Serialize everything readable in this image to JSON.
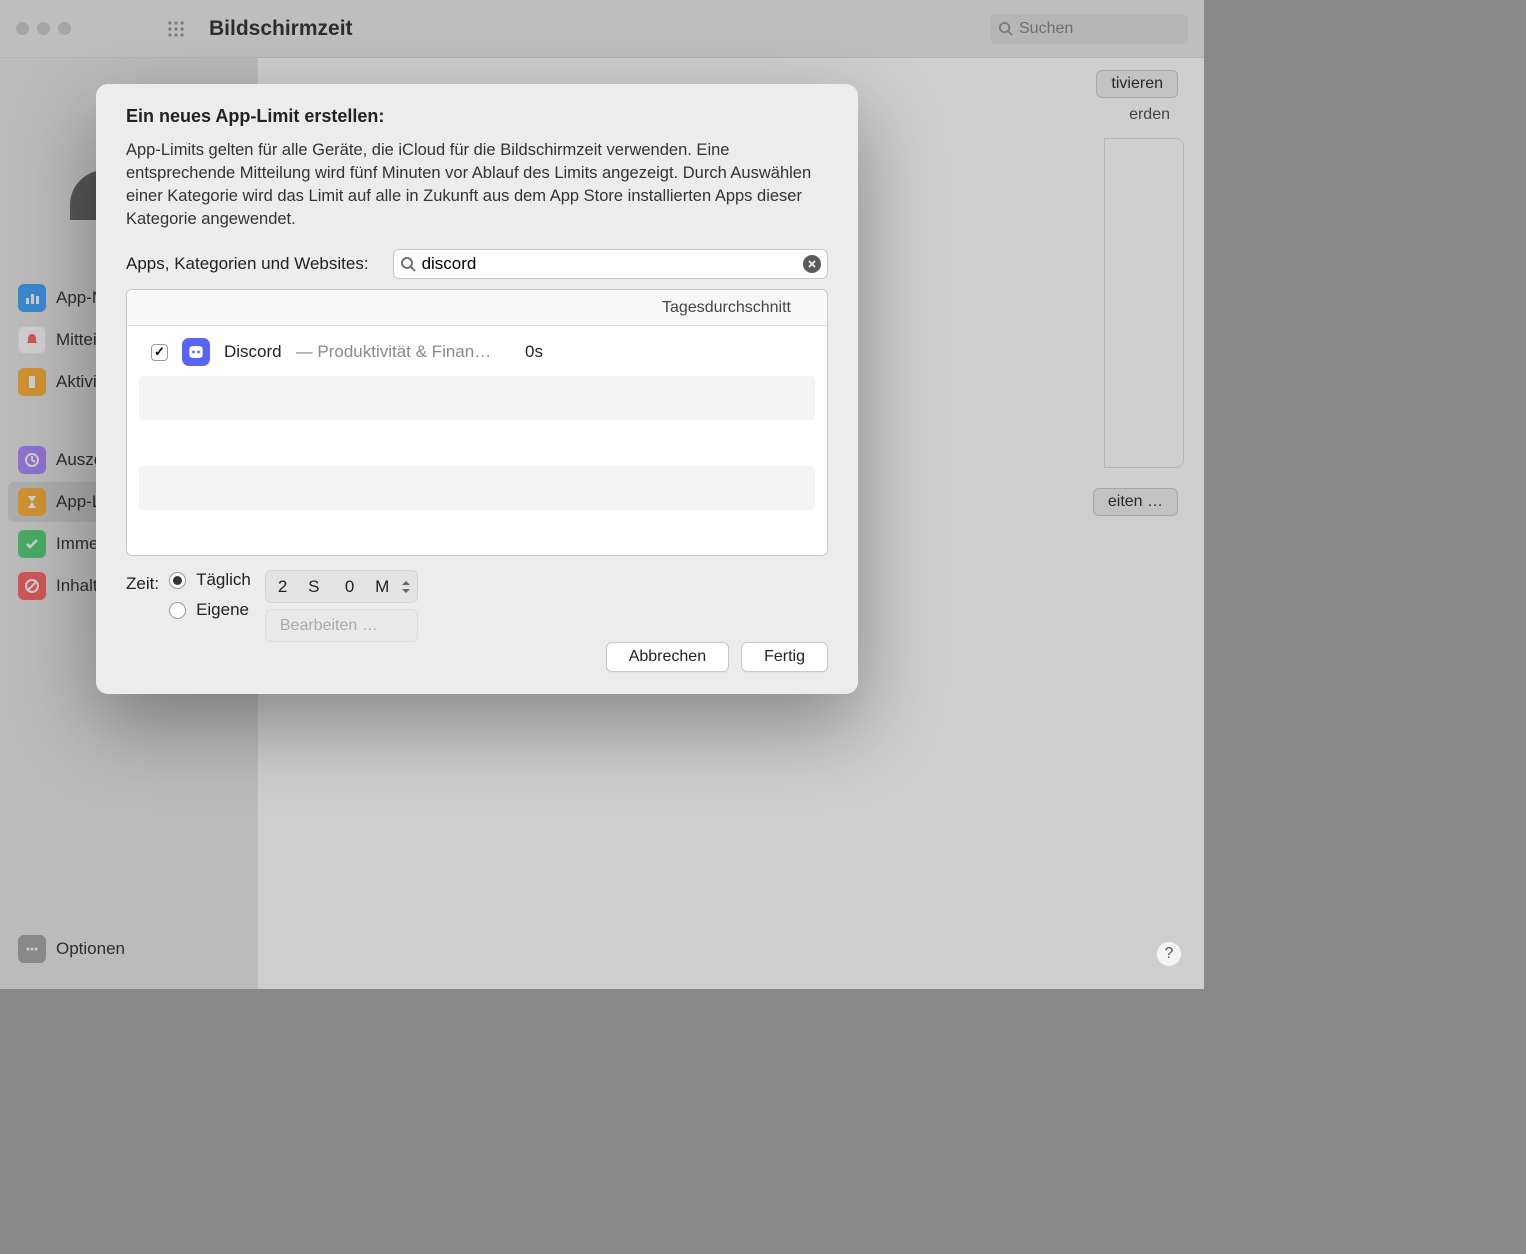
{
  "window": {
    "title": "Bildschirmzeit",
    "search_placeholder": "Suchen"
  },
  "sidebar": {
    "items": [
      {
        "label": "App-Nutzung"
      },
      {
        "label": "Mitteilungen"
      },
      {
        "label": "Aktivierungen"
      }
    ],
    "items2": [
      {
        "label": "Auszeit"
      },
      {
        "label": "App-Limits"
      },
      {
        "label": "Immer erlauben"
      },
      {
        "label": "Inhalt & Datenschutz"
      }
    ],
    "options_label": "Optionen"
  },
  "background": {
    "button_partial1": "tivieren",
    "text_partial": "erden",
    "button_partial2": "eiten …"
  },
  "modal": {
    "title": "Ein neues App-Limit erstellen:",
    "description": "App-Limits gelten für alle Geräte, die iCloud für die Bildschirmzeit verwenden. Eine entsprechende Mitteilung wird fünf Minuten vor Ablauf des Limits angezeigt. Durch Auswählen einer Kategorie wird das Limit auf alle in Zukunft aus dem App Store installierten Apps dieser Kategorie angewendet.",
    "search_label": "Apps, Kategorien und Websites:",
    "search_value": "discord",
    "list": {
      "header_right": "Tagesdurchschnitt",
      "row": {
        "name": "Discord",
        "separator": " — ",
        "category": "Produktivität & Finan…",
        "avg": "0s"
      }
    },
    "time": {
      "label": "Zeit:",
      "daily_label": "Täglich",
      "custom_label": "Eigene",
      "hours_val": "2",
      "hours_unit": "S",
      "mins_val": "0",
      "mins_unit": "M",
      "edit_label": "Bearbeiten …"
    },
    "cancel": "Abbrechen",
    "done": "Fertig"
  },
  "help": "?"
}
